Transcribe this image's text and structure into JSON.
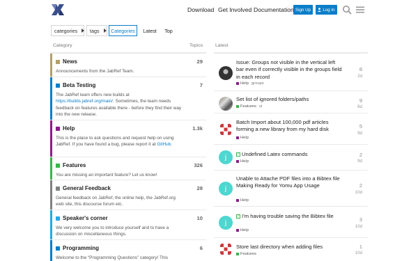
{
  "colors": {
    "accent": "#0a7ec9",
    "news": "#b3a06a",
    "beta": "#0a7ec9",
    "help": "#8c1c8c",
    "features": "#3ab54a",
    "feedback": "#808281",
    "speakers": "#25aae2",
    "programming": "#0a7ec9"
  },
  "header": {
    "logo_icon": "jabref-logo-icon",
    "nav": [
      "Download",
      "Get Involved",
      "Documentation"
    ],
    "signup": "Sign Up",
    "login": "Log In",
    "search_icon": "search-icon",
    "menu_icon": "hamburger-menu-icon"
  },
  "subnav": {
    "categories_select": "categories",
    "tags_select": "tags",
    "tabs": [
      "Categories",
      "Latest",
      "Top"
    ]
  },
  "columns": {
    "category": "Category",
    "topics": "Topics",
    "latest": "Latest"
  },
  "categories": [
    {
      "name": "News",
      "count": "29",
      "desc": "Announcements from the JabRef Team."
    },
    {
      "name": "Beta Testing",
      "count": "7",
      "desc_pre": "The JabRef team offers new builds at ",
      "desc_link": "https://builds.jabref.org/main/",
      "desc_post": ". Sometimes, the team needs feedback on features available there - before they find their way into the new release."
    },
    {
      "name": "Help",
      "count": "1.3k",
      "desc_pre": "This is the place to ask questions and request help on using JabRef. If you have found a bug, please report it at ",
      "desc_link": "GitHub",
      "desc_post": "."
    },
    {
      "name": "Features",
      "count": "326",
      "desc": "You are missing an important feature? Let us know!"
    },
    {
      "name": "General Feedback",
      "count": "28",
      "desc": "General feedback on JabRef, the online help, the JabRef.org web site, this discourse forum etc."
    },
    {
      "name": "Speaker's corner",
      "count": "10",
      "desc": "We very welcome you to introduce yourself and to have a discussion on miscellaneous things."
    },
    {
      "name": "Programming",
      "count": "6",
      "desc": "Welcome to the “Programming Questions” category! This"
    }
  ],
  "topics": [
    {
      "title": "Issue: Groups not visible in the vertical left bar even if correctly visible in the groups field in each record",
      "category": "Help",
      "tag": "groups",
      "replies": "8",
      "age": "2d"
    },
    {
      "title": "Set list of ignored folders/paths",
      "category": "Features",
      "tag": "ui",
      "replies": "9",
      "age": "6d"
    },
    {
      "title": "Batch Import about 100,000 pdf articles forming a new library from my hard disk",
      "category": "Help",
      "tag": "",
      "replies": "5",
      "age": "9d"
    },
    {
      "title": "Undefined Latex commands",
      "category": "Help",
      "tag": "",
      "replies": "2",
      "age": "9d",
      "solved": true
    },
    {
      "title": "Unable to Attache PDF files into a Bibtex file Making Ready for Yomu App Usage",
      "category": "Help",
      "tag": "",
      "replies": "2",
      "age": "10d"
    },
    {
      "title": "I’m having trouble saving the Bibtex file",
      "category": "Help",
      "tag": "",
      "replies": "3",
      "age": "10d",
      "solved": true
    },
    {
      "title": "Store last directory when adding files",
      "category": "Features",
      "tag": "",
      "replies": "1",
      "age": "10d"
    }
  ]
}
